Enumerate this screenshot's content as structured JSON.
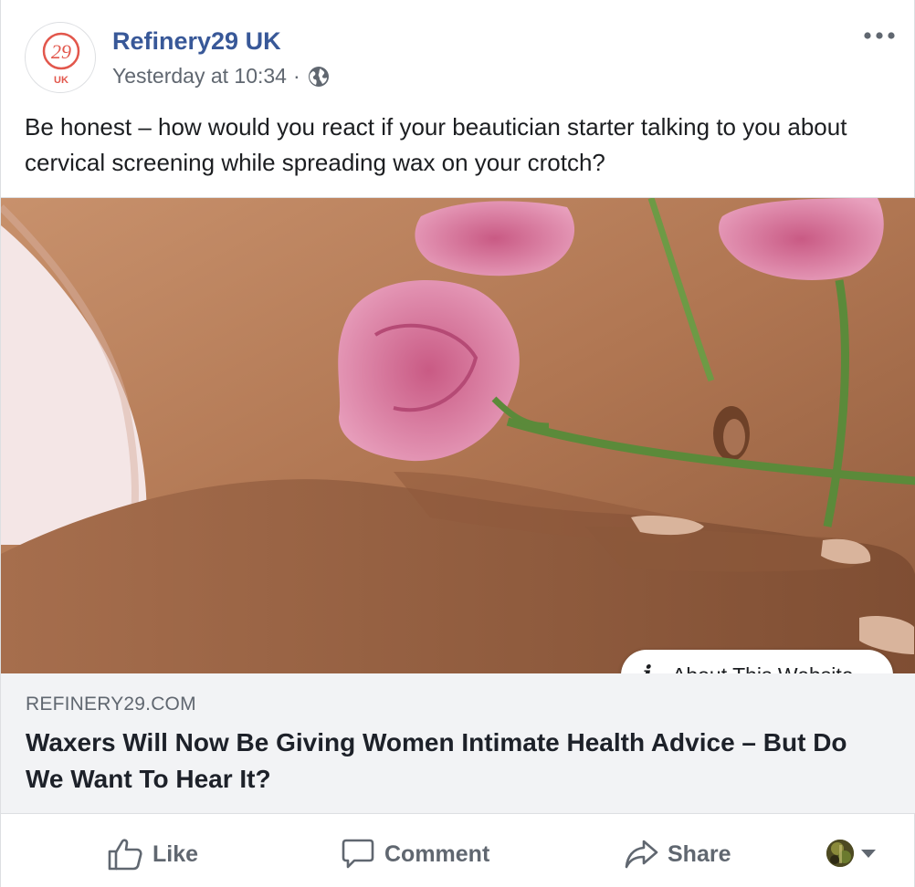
{
  "post": {
    "page_name": "Refinery29 UK",
    "avatar_logo_text": "29",
    "avatar_region_text": "UK",
    "timestamp": "Yesterday at 10:34",
    "separator": "·",
    "privacy_icon": "globe-icon",
    "more_icon": "more-options-icon",
    "text": "Be honest – how would you react if your beautician starter talking to you about cervical screening while spreading wax on your crotch?"
  },
  "media": {
    "about_label": "About This Website",
    "about_icon": "info-icon"
  },
  "link_card": {
    "domain": "REFINERY29.COM",
    "headline": "Waxers Will Now Be Giving Women Intimate Health Advice – But Do We Want To Hear It?"
  },
  "actions": {
    "like_label": "Like",
    "comment_label": "Comment",
    "share_label": "Share"
  },
  "colors": {
    "page_name": "#385898",
    "meta": "#606770",
    "logo_red": "#e2574c",
    "card_bg": "#f2f3f5"
  }
}
